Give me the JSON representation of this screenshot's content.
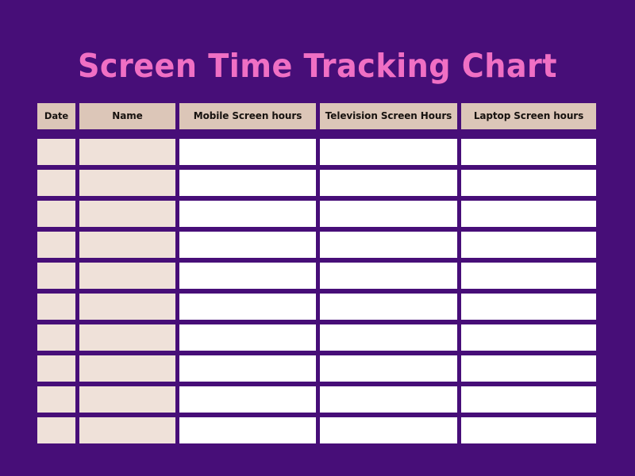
{
  "page": {
    "background_color": "#470E78",
    "title": "Screen Time Tracking Chart",
    "title_color": "#F06FC4"
  },
  "table": {
    "header_background": "#DCC6B8",
    "tinted_cell_background": "#EFE1D9",
    "blank_cell_background": "#FFFFFF",
    "grid_color": "#470E78",
    "columns": [
      {
        "key": "date",
        "label": "Date",
        "fill": "tinted"
      },
      {
        "key": "name",
        "label": "Name",
        "fill": "tinted"
      },
      {
        "key": "mobile",
        "label": "Mobile Screen hours",
        "fill": "blank"
      },
      {
        "key": "television",
        "label": "Television Screen Hours",
        "fill": "blank"
      },
      {
        "key": "laptop",
        "label": "Laptop Screen hours",
        "fill": "blank"
      }
    ],
    "row_count": 10,
    "rows": [
      {
        "date": "",
        "name": "",
        "mobile": "",
        "television": "",
        "laptop": ""
      },
      {
        "date": "",
        "name": "",
        "mobile": "",
        "television": "",
        "laptop": ""
      },
      {
        "date": "",
        "name": "",
        "mobile": "",
        "television": "",
        "laptop": ""
      },
      {
        "date": "",
        "name": "",
        "mobile": "",
        "television": "",
        "laptop": ""
      },
      {
        "date": "",
        "name": "",
        "mobile": "",
        "television": "",
        "laptop": ""
      },
      {
        "date": "",
        "name": "",
        "mobile": "",
        "television": "",
        "laptop": ""
      },
      {
        "date": "",
        "name": "",
        "mobile": "",
        "television": "",
        "laptop": ""
      },
      {
        "date": "",
        "name": "",
        "mobile": "",
        "television": "",
        "laptop": ""
      },
      {
        "date": "",
        "name": "",
        "mobile": "",
        "television": "",
        "laptop": ""
      },
      {
        "date": "",
        "name": "",
        "mobile": "",
        "television": "",
        "laptop": ""
      }
    ]
  }
}
